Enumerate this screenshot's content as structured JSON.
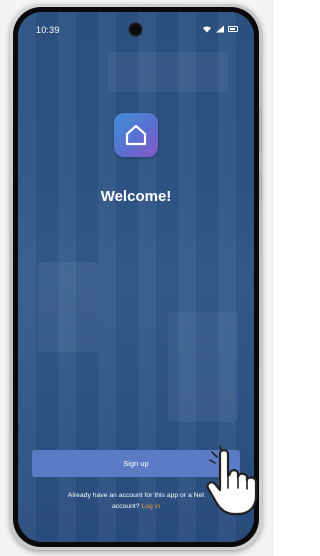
{
  "status_bar": {
    "time": "10:39"
  },
  "app": {
    "logo_icon": "home-icon",
    "welcome_title": "Welcome!"
  },
  "actions": {
    "signup_label": "Sign up",
    "footer_line1": "Already have an account for this app or a Net",
    "footer_line2_prefix": "account?",
    "login_label": "Log in"
  },
  "colors": {
    "background": "#2c5282",
    "signup_button": "#5b7cc4",
    "login_link": "#f29a3a",
    "logo_gradient_start": "#3f8fd8",
    "logo_gradient_end": "#8a58c8"
  }
}
